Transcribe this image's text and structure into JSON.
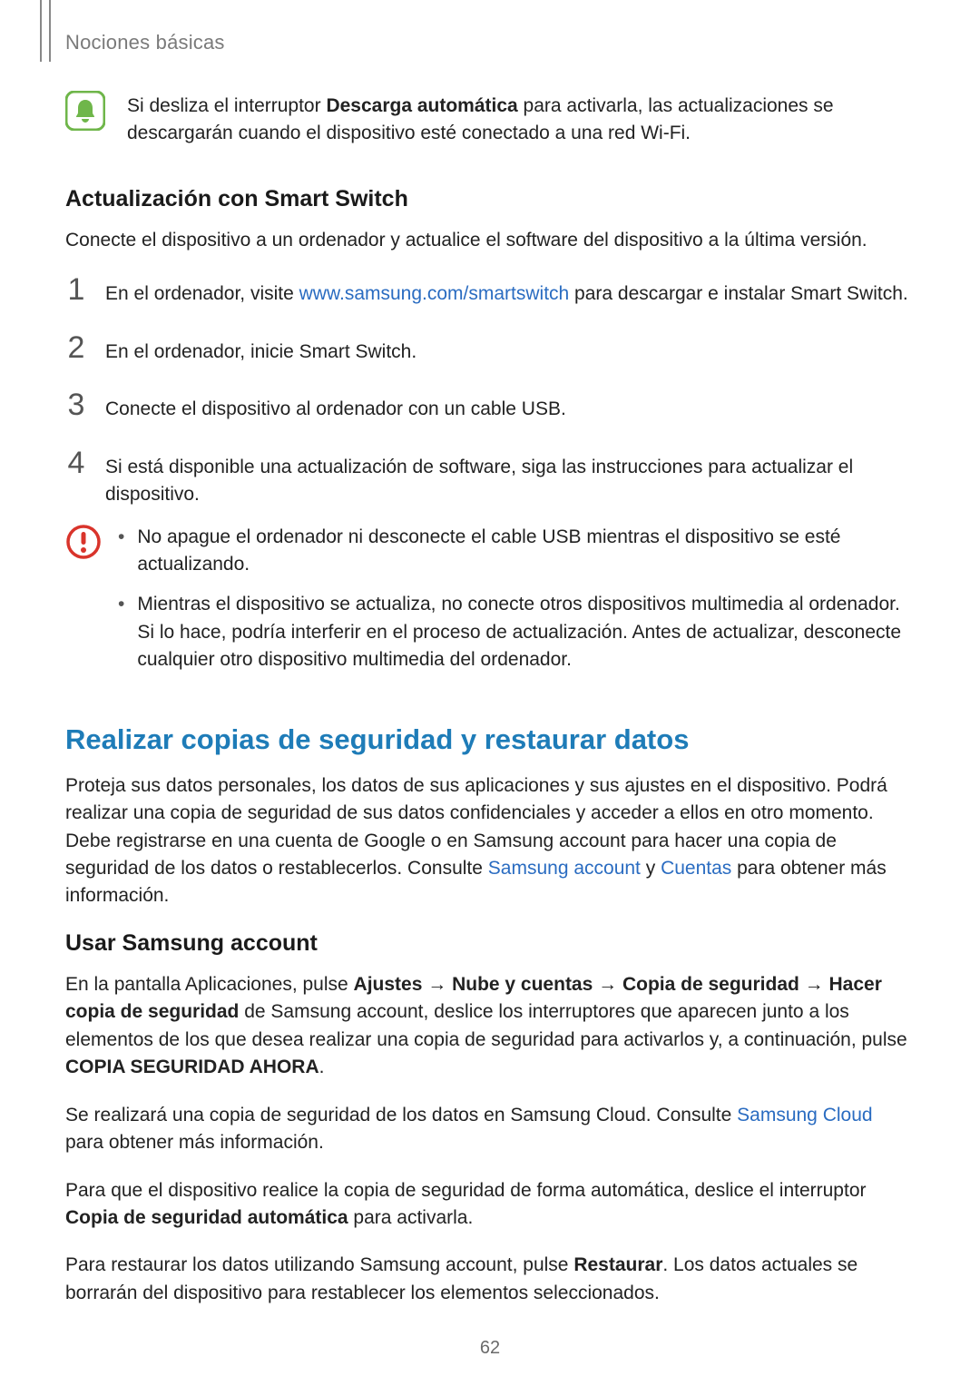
{
  "breadcrumb": "Nociones básicas",
  "note": {
    "prefix": "Si desliza el interruptor ",
    "bold": "Descarga automática",
    "suffix": " para activarla, las actualizaciones se descargarán cuando el dispositivo esté conectado a una red Wi-Fi."
  },
  "section1": {
    "title": "Actualización con Smart Switch",
    "intro": "Conecte el dispositivo a un ordenador y actualice el software del dispositivo a la última versión."
  },
  "steps": {
    "n1": "1",
    "s1_pre": "En el ordenador, visite ",
    "s1_link": "www.samsung.com/smartswitch",
    "s1_post": " para descargar e instalar Smart Switch.",
    "n2": "2",
    "s2": "En el ordenador, inicie Smart Switch.",
    "n3": "3",
    "s3": "Conecte el dispositivo al ordenador con un cable USB.",
    "n4": "4",
    "s4": "Si está disponible una actualización de software, siga las instrucciones para actualizar el dispositivo."
  },
  "caution": {
    "b1": "No apague el ordenador ni desconecte el cable USB mientras el dispositivo se esté actualizando.",
    "b2": "Mientras el dispositivo se actualiza, no conecte otros dispositivos multimedia al ordenador. Si lo hace, podría interferir en el proceso de actualización. Antes de actualizar, desconecte cualquier otro dispositivo multimedia del ordenador."
  },
  "section2": {
    "title": "Realizar copias de seguridad y restaurar datos",
    "intro_pre": "Proteja sus datos personales, los datos de sus aplicaciones y sus ajustes en el dispositivo. Podrá realizar una copia de seguridad de sus datos confidenciales y acceder a ellos en otro momento. Debe registrarse en una cuenta de Google o en Samsung account para hacer una copia de seguridad de los datos o restablecerlos. Consulte ",
    "link1": "Samsung account",
    "intro_mid": " y ",
    "link2": "Cuentas",
    "intro_post": " para obtener más información."
  },
  "section3": {
    "title": "Usar Samsung account",
    "p1_a": "En la pantalla Aplicaciones, pulse ",
    "p1_b1": "Ajustes",
    "p1_arrow": " → ",
    "p1_b2": "Nube y cuentas",
    "p1_b3": "Copia de seguridad",
    "p1_b4": "Hacer copia de seguridad",
    "p1_c": " de Samsung account, deslice los interruptores que aparecen junto a los elementos de los que desea realizar una copia de seguridad para activarlos y, a continuación, pulse ",
    "p1_b5": "COPIA SEGURIDAD AHORA",
    "p1_d": ".",
    "p2_a": "Se realizará una copia de seguridad de los datos en Samsung Cloud. Consulte ",
    "p2_link": "Samsung Cloud",
    "p2_b": " para obtener más información.",
    "p3_a": "Para que el dispositivo realice la copia de seguridad de forma automática, deslice el interruptor ",
    "p3_bold": "Copia de seguridad automática",
    "p3_b": " para activarla.",
    "p4_a": "Para restaurar los datos utilizando Samsung account, pulse ",
    "p4_bold": "Restaurar",
    "p4_b": ". Los datos actuales se borrarán del dispositivo para restablecer los elementos seleccionados."
  },
  "page_number": "62",
  "bullet_dot": "•"
}
